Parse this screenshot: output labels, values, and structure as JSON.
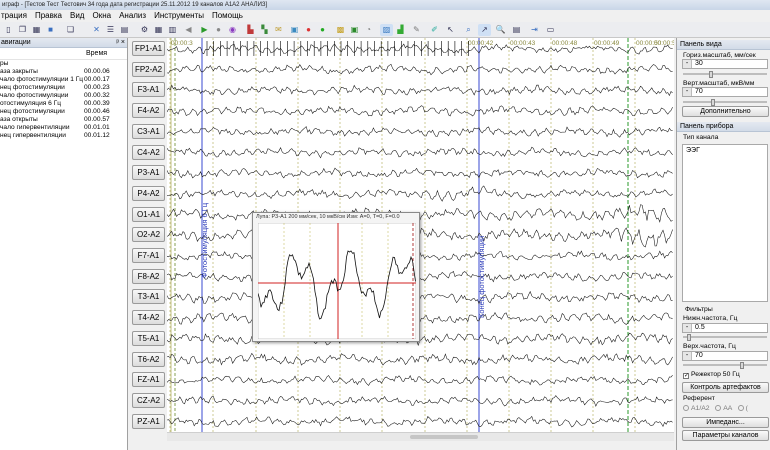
{
  "window": {
    "title": "играф - [Тестов Тест Тестович 34 года дата регистрации 25.11.2012 19 каналов А1А2 АНАЛИЗ]"
  },
  "menu": [
    "трация",
    "Правка",
    "Вид",
    "Окна",
    "Анализ",
    "Инструменты",
    "Помощь"
  ],
  "toolbar_icons": [
    "doc-icon",
    "new-window-icon",
    "map-icon",
    "stop-icon",
    "copy-icon",
    "tools-icon",
    "list-icon",
    "table-icon",
    "settings-icon",
    "grid-icon",
    "layout-icon",
    "arrow-left-icon",
    "play-icon",
    "record-icon",
    "circle-icon",
    "spectrum-icon",
    "chart-icon",
    "mail-icon",
    "image-icon",
    "red-circle-icon",
    "green-circle-icon",
    "blocks-icon",
    "photo-icon",
    "gauge-icon",
    "folder-icon",
    "stats-icon",
    "pencil-icon",
    "brush-icon",
    "pointer-icon",
    "zoom-icon",
    "cursor-icon",
    "magnifier-icon",
    "print-icon",
    "export-icon",
    "monitor-icon"
  ],
  "nav": {
    "title": "авигации",
    "col_time": "Время",
    "rows": [
      {
        "event": "ры",
        "time": ""
      },
      {
        "event": "аза закрыты",
        "time": "00.00.06"
      },
      {
        "event": "чало фотостимуляции 1 Гц",
        "time": "00.00.17"
      },
      {
        "event": "нец фотостимуляции",
        "time": "00.00.23"
      },
      {
        "event": "чало фотостимуляции",
        "time": "00.00.32"
      },
      {
        "event": "отостимуляция 6 Гц",
        "time": "00.00.39"
      },
      {
        "event": "нец фотостимуляции",
        "time": "00.00.46"
      },
      {
        "event": "аза открыты",
        "time": "00.00.57"
      },
      {
        "event": "чало гипервентиляции",
        "time": "00.01.01"
      },
      {
        "event": "нец гипервентиляции",
        "time": "00.01.12"
      }
    ]
  },
  "channels": [
    "FP1-A1",
    "FP2-A2",
    "F3-A1",
    "F4-A2",
    "C3-A1",
    "C4-A2",
    "P3-A1",
    "P4-A2",
    "O1-A1",
    "O2-A2",
    "F7-A1",
    "F8-A2",
    "T3-A1",
    "T4-A2",
    "T5-A1",
    "T6-A2",
    "FZ-A1",
    "CZ-A2",
    "PZ-A1"
  ],
  "time_marks": [
    "00:00:3",
    "00:00:42",
    "00:00:43",
    "00:00:48",
    "00:00:49",
    "00:00:50",
    "00:00:51"
  ],
  "annotations": {
    "left": "Фотостимуляция 6 Гц",
    "right": "Конец фотостимуляции"
  },
  "loupe": {
    "title": "Лупа: P3-A1 200 мм/сек, 10 мкВ/см Изм: A=0, T=0, F=0.0"
  },
  "right_panel": {
    "view_title": "Панель вида",
    "hscale_label": "Гориз.масштаб, мм/сек",
    "hscale_value": "30",
    "vscale_label": "Верт.масштаб, мкВ/мм",
    "vscale_value": "70",
    "more_button": "Дополнительно",
    "device_title": "Панель прибора",
    "chtype_label": "Тип канала",
    "chtype_value": "ЭЭГ",
    "filters_label": "Фильтры",
    "lowfreq_label": "Нижн.частота, Гц",
    "lowfreq_value": "0.5",
    "highfreq_label": "Верх.частота, Гц",
    "highfreq_value": "70",
    "notch_label": "Режектор 50 Гц",
    "artifact_button": "Контроль артефактов",
    "reference_label": "Референт",
    "ref_options": [
      "A1/A2",
      "AA",
      "("
    ],
    "impedance_button": "Импеданс...",
    "params_button": "Параметры каналов"
  }
}
